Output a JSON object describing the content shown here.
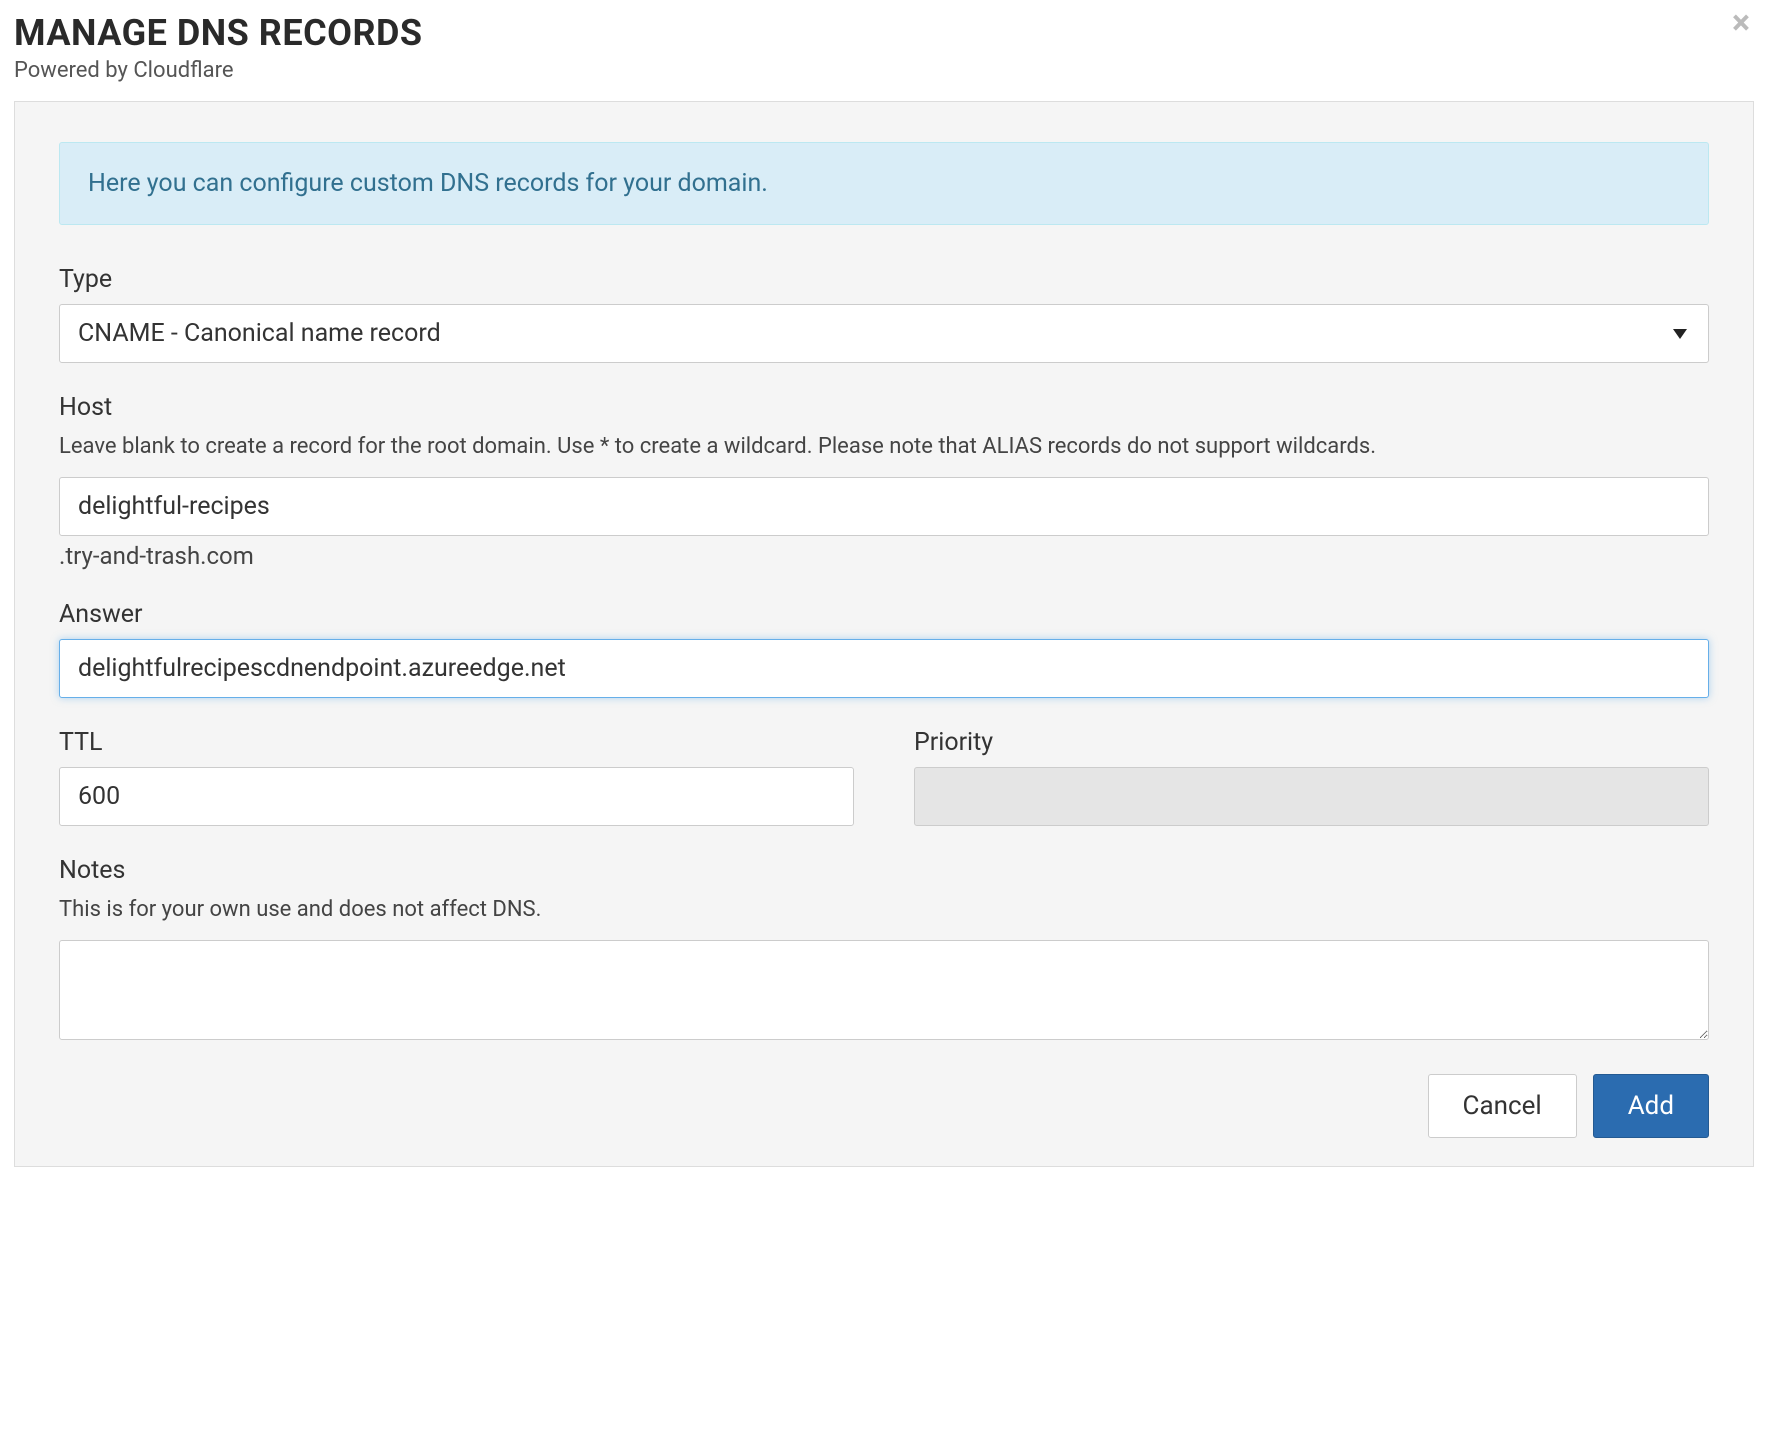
{
  "header": {
    "title": "MANAGE DNS RECORDS",
    "subtitle": "Powered by Cloudflare"
  },
  "banner": {
    "text": "Here you can configure custom DNS records for your domain."
  },
  "form": {
    "type": {
      "label": "Type",
      "value": "CNAME - Canonical name record"
    },
    "host": {
      "label": "Host",
      "help": "Leave blank to create a record for the root domain. Use * to create a wildcard. Please note that ALIAS records do not support wildcards.",
      "value": "delightful-recipes",
      "suffix": ".try-and-trash.com"
    },
    "answer": {
      "label": "Answer",
      "value": "delightfulrecipescdnendpoint.azureedge.net"
    },
    "ttl": {
      "label": "TTL",
      "value": "600"
    },
    "priority": {
      "label": "Priority",
      "value": ""
    },
    "notes": {
      "label": "Notes",
      "help": "This is for your own use and does not affect DNS.",
      "value": ""
    }
  },
  "buttons": {
    "cancel": "Cancel",
    "add": "Add"
  }
}
